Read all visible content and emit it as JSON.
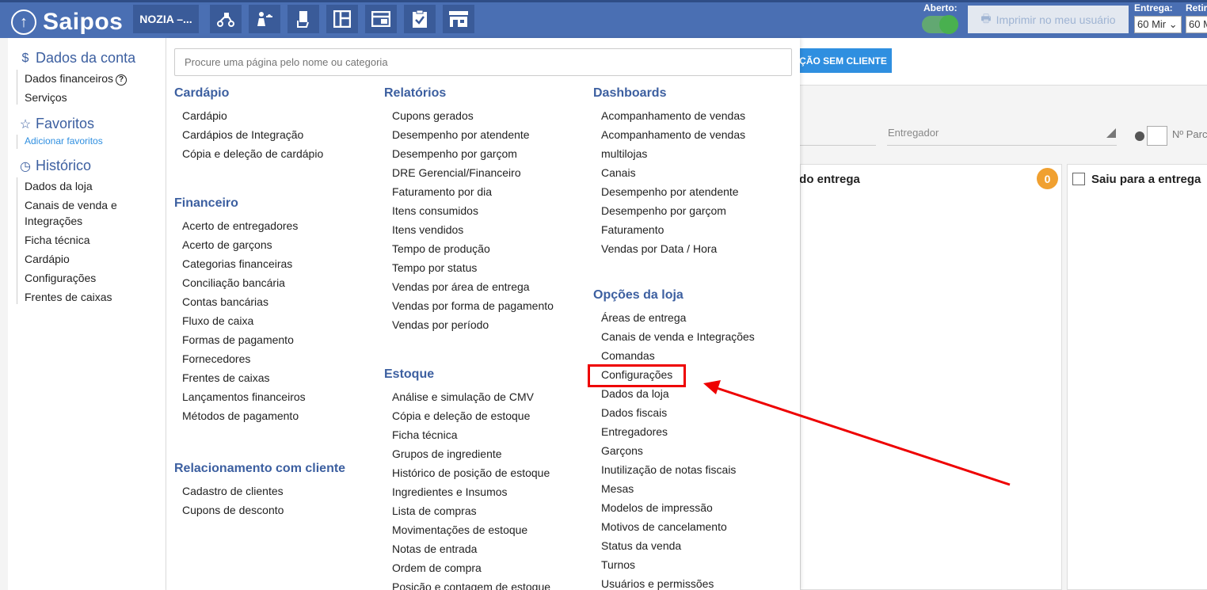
{
  "topbar": {
    "logo_text": "Saipos",
    "store_name": "NOZIA –...",
    "aberto_label": "Aberto:",
    "print_label": "Imprimir no meu usuário",
    "entrega_label": "Entrega:",
    "entrega_value": "60 Mir",
    "retira_label": "Retira",
    "retira_value": "60 M"
  },
  "background": {
    "blue_button": "ÇÃO SEM CLIENTE",
    "entregador_placeholder": "Entregador",
    "nparce": "Nº Parce",
    "col1_title": "ndo entrega",
    "col1_badge": "0",
    "col2_title": "Saiu para a entrega"
  },
  "sidebar": {
    "conta_title": "Dados da conta",
    "conta_items": [
      "Dados financeiros",
      "Serviços"
    ],
    "favoritos_title": "Favoritos",
    "favoritos_link": "Adicionar favoritos",
    "historico_title": "Histórico",
    "historico_items": [
      "Dados da loja",
      "Canais de venda e",
      "Integrações",
      "Ficha técnica",
      "Cardápio",
      "Configurações",
      "Frentes de caixas"
    ]
  },
  "menu": {
    "search_placeholder": "Procure uma página pelo nome ou categoria",
    "cardapio": {
      "title": "Cardápio",
      "items": [
        "Cardápio",
        "Cardápios de Integração",
        "Cópia e deleção de cardápio"
      ]
    },
    "financeiro": {
      "title": "Financeiro",
      "items": [
        "Acerto de entregadores",
        "Acerto de garçons",
        "Categorias financeiras",
        "Conciliação bancária",
        "Contas bancárias",
        "Fluxo de caixa",
        "Formas de pagamento",
        "Fornecedores",
        "Frentes de caixas",
        "Lançamentos financeiros",
        "Métodos de pagamento"
      ]
    },
    "relacionamento": {
      "title": "Relacionamento com cliente",
      "items": [
        "Cadastro de clientes",
        "Cupons de desconto"
      ]
    },
    "relatorios": {
      "title": "Relatórios",
      "items": [
        "Cupons gerados",
        "Desempenho por atendente",
        "Desempenho por garçom",
        "DRE Gerencial/Financeiro",
        "Faturamento por dia",
        "Itens consumidos",
        "Itens vendidos",
        "Tempo de produção",
        "Tempo por status",
        "Vendas por área de entrega",
        "Vendas por forma de pagamento",
        "Vendas por período"
      ]
    },
    "estoque": {
      "title": "Estoque",
      "items": [
        "Análise e simulação de CMV",
        "Cópia e deleção de estoque",
        "Ficha técnica",
        "Grupos de ingrediente",
        "Histórico de posição de estoque",
        "Ingredientes e Insumos",
        "Lista de compras",
        "Movimentações de estoque",
        "Notas de entrada",
        "Ordem de compra",
        "Posição e contagem de estoque"
      ]
    },
    "dashboards": {
      "title": "Dashboards",
      "items": [
        "Acompanhamento de vendas",
        "Acompanhamento de vendas",
        "multilojas",
        "Canais",
        "Desempenho por atendente",
        "Desempenho por garçom",
        "Faturamento",
        "Vendas por Data / Hora"
      ]
    },
    "opcoes": {
      "title": "Opções da loja",
      "items": [
        "Áreas de entrega",
        "Canais de venda e Integrações",
        "Comandas",
        "Configurações",
        "Dados da loja",
        "Dados fiscais",
        "Entregadores",
        "Garçons",
        "Inutilização de notas fiscais",
        "Mesas",
        "Modelos de impressão",
        "Motivos de cancelamento",
        "Status da venda",
        "Turnos",
        "Usuários e permissões"
      ]
    }
  },
  "colors": {
    "topbar": "#4a6fb3",
    "category": "#3c5fa0",
    "highlight": "#ee0000"
  }
}
